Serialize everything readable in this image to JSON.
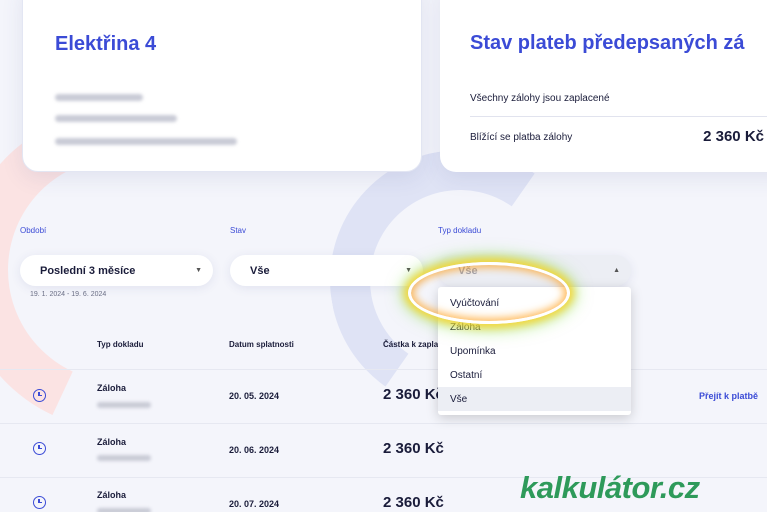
{
  "meter_card": {
    "title": "Elektřina 4"
  },
  "payments_card": {
    "title": "Stav plateb předepsaných zá",
    "status_all_paid": "Všechny zálohy jsou zaplacené",
    "upcoming_label": "Blížící se platba zálohy",
    "upcoming_amount": "2 360 Kč"
  },
  "filters": {
    "period_label": "Období",
    "period_value": "Poslední 3 měsíce",
    "period_range": "19. 1. 2024 - 19. 6. 2024",
    "status_label": "Stav",
    "status_value": "Vše",
    "type_label": "Typ dokladu",
    "type_value": "Vše",
    "type_options": [
      "Vyúčtování",
      "Záloha",
      "Upomínka",
      "Ostatní",
      "Vše"
    ],
    "type_selected": "Vše"
  },
  "table": {
    "headers": {
      "type": "Typ dokladu",
      "due_date": "Datum splatnosti",
      "amount": "Částka k zapla"
    },
    "rows": [
      {
        "type": "Záloha",
        "due_date": "20. 05. 2024",
        "amount": "2 360 Kč",
        "action": "Přejít k platbě"
      },
      {
        "type": "Záloha",
        "due_date": "20. 06. 2024",
        "amount": "2 360 Kč",
        "action": ""
      },
      {
        "type": "Záloha",
        "due_date": "20. 07. 2024",
        "amount": "2 360 Kč",
        "action": ""
      }
    ]
  },
  "watermark": {
    "text": "kalkulátor.cz"
  },
  "colors": {
    "accent": "#3b4bd6",
    "background": "#f4f5fb",
    "watermark": "#2e9a5a"
  }
}
